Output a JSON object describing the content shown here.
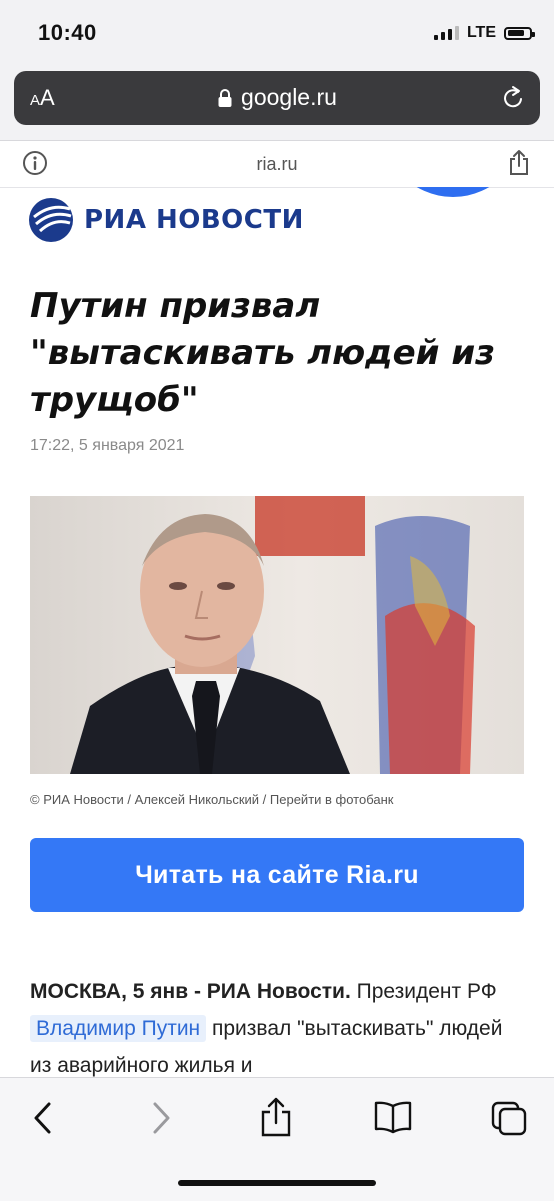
{
  "status_bar": {
    "time": "10:40",
    "network": "LTE",
    "signal_bars": 3
  },
  "browser": {
    "text_size_button": "AA",
    "url": "google.ru",
    "site_domain": "ria.ru",
    "icons": {
      "lock": "lock-icon",
      "reload": "reload-icon",
      "info": "info-icon",
      "share": "share-icon",
      "back": "chevron-left-icon",
      "forward": "chevron-right-icon",
      "bookmarks": "book-icon",
      "tabs": "tabs-icon"
    }
  },
  "article": {
    "publisher": "РИА НОВОСТИ",
    "headline": "Путин призвал \"вытаскивать людей из трущоб\"",
    "published": "17:22, 5 января 2021",
    "photo_caption": "© РИА Новости / Алексей Никольский / Перейти в фотобанк",
    "read_button": "Читать на сайте Ria.ru",
    "body": {
      "lead": "МОСКВА, 5 янв - РИА Новости.",
      "text_1": " Президент РФ ",
      "person_link": "Владимир Путин",
      "text_2": " призвал \"вытаскивать\" людей из аварийного жилья и"
    }
  },
  "colors": {
    "accent_blue": "#3478f6",
    "logo_blue": "#1b3a8c",
    "link_blue": "#2f6bd6"
  }
}
